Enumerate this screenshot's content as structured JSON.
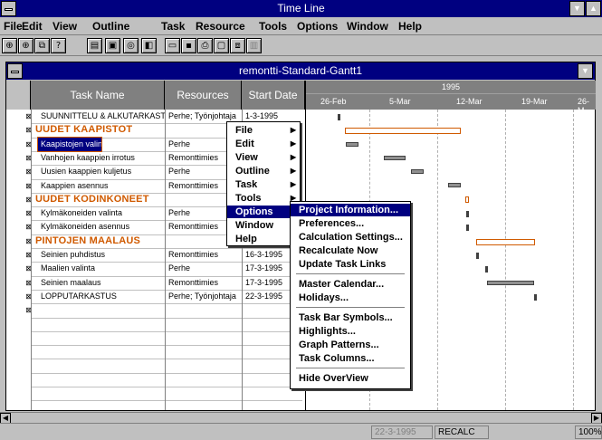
{
  "app": {
    "title": "Time Line"
  },
  "menubar": [
    "File",
    "Edit",
    "View",
    "Outline",
    "Task",
    "Resource",
    "Tools",
    "Options",
    "Window",
    "Help"
  ],
  "toolbar_icons": [
    "indent-icon",
    "outdent-icon",
    "link-icon",
    "help-icon",
    "task-view-icon",
    "resource-view-icon",
    "calendar-view-icon",
    "gantt-icon",
    "open-icon",
    "save-icon",
    "print-icon",
    "preview-icon",
    "copy-icon",
    "format-icon"
  ],
  "window": {
    "title": "remontti-Standard-Gantt1"
  },
  "columns": {
    "task_name": "Task Name",
    "resources": "Resources",
    "start_date": "Start Date"
  },
  "gantt": {
    "year": "1995",
    "weeks": [
      "26-Feb",
      "5-Mar",
      "12-Mar",
      "19-Mar",
      "26-M"
    ]
  },
  "rows": [
    {
      "name": "SUUNNITTELU & ALKUTARKAST",
      "res": "Perhe; Työnjohtaja",
      "start": "1-3-1995",
      "group": false
    },
    {
      "name": "UUDET KAAPISTOT",
      "res": "",
      "start": "",
      "group": true
    },
    {
      "name": "Kaapistojen valinta",
      "res": "Perhe",
      "start": "",
      "group": false,
      "selected": true
    },
    {
      "name": "Vanhojen kaappien irrotus",
      "res": "Remonttimies",
      "start": "",
      "group": false
    },
    {
      "name": "Uusien kaappien kuljetus",
      "res": "Perhe",
      "start": "",
      "group": false
    },
    {
      "name": "Kaappien asennus",
      "res": "Remonttimies",
      "start": "",
      "group": false
    },
    {
      "name": "UUDET KODINKONEET",
      "res": "",
      "start": "",
      "group": true
    },
    {
      "name": "Kylmäkoneiden valinta",
      "res": "Perhe",
      "start": "",
      "group": false
    },
    {
      "name": "Kylmäkoneiden asennus",
      "res": "Remonttimies",
      "start": "",
      "group": false
    },
    {
      "name": "PINTOJEN MAALAUS",
      "res": "",
      "start": "16-3-1995",
      "group": true
    },
    {
      "name": "Seinien puhdistus",
      "res": "Remonttimies",
      "start": "16-3-1995",
      "group": false
    },
    {
      "name": "Maalien valinta",
      "res": "Perhe",
      "start": "17-3-1995",
      "group": false
    },
    {
      "name": "Seinien maalaus",
      "res": "Remonttimies",
      "start": "17-3-1995",
      "group": false
    },
    {
      "name": "LOPPUTARKASTUS",
      "res": "Perhe; Työnjohtaja",
      "start": "22-3-1995",
      "group": false
    }
  ],
  "main_menu": [
    "File",
    "Edit",
    "View",
    "Outline",
    "Task",
    "Tools",
    "Options",
    "Window",
    "Help"
  ],
  "options_menu": [
    "Project Information...",
    "Preferences...",
    "Calculation Settings...",
    "Recalculate Now",
    "Update Task Links",
    "Master Calendar...",
    "Holidays...",
    "Task Bar Symbols...",
    "Highlights...",
    "Graph Patterns...",
    "Task Columns...",
    "Hide OverView"
  ],
  "status": {
    "date": "22-3-1995",
    "mode": "RECALC",
    "zoom": "100%"
  }
}
